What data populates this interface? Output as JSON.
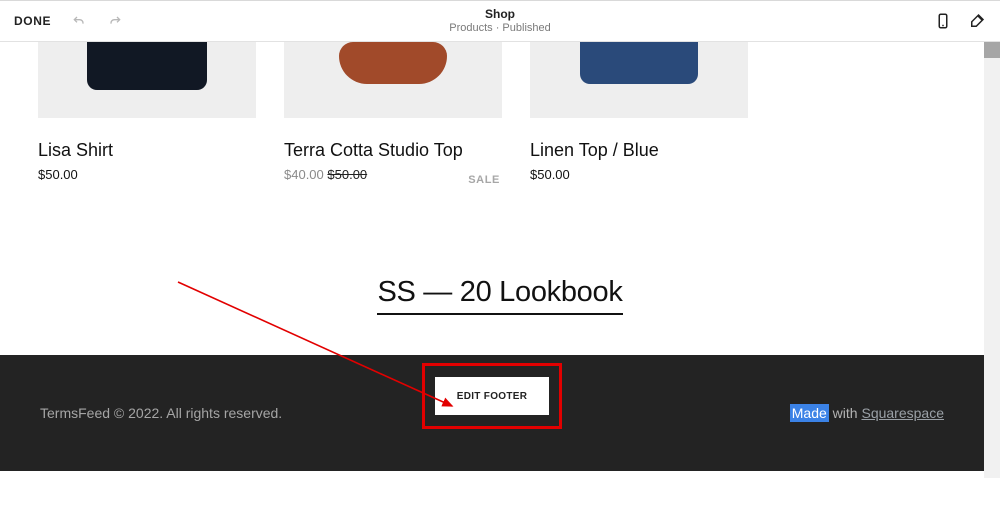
{
  "topbar": {
    "done": "DONE",
    "title": "Shop",
    "subtitle": "Products · Published"
  },
  "products": [
    {
      "name": "Lisa Shirt",
      "price": "$50.00"
    },
    {
      "name": "Terra Cotta Studio Top",
      "sale_price": "$40.00",
      "orig_price": "$50.00",
      "badge": "SALE"
    },
    {
      "name": "Linen Top / Blue",
      "price": "$50.00"
    }
  ],
  "lookbook": {
    "title": "SS — 20 Lookbook"
  },
  "footer": {
    "copyright": "TermsFeed © 2022. All rights reserved.",
    "made": "Made",
    "with": " with ",
    "sq": "Squarespace",
    "edit_label": "EDIT FOOTER"
  }
}
